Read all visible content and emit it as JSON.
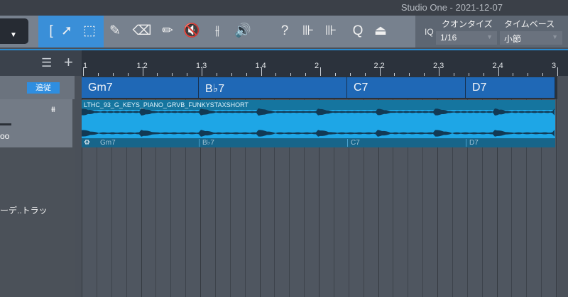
{
  "window": {
    "title": "Studio One - 2021-12-07"
  },
  "toolbar": {
    "tools": [
      {
        "name": "range-bracket-icon",
        "glyph": "["
      },
      {
        "name": "arrow-tool-icon",
        "glyph": "➚"
      },
      {
        "name": "range-tool-icon",
        "glyph": "⬚"
      },
      {
        "name": "split-tool-icon",
        "glyph": "✎"
      },
      {
        "name": "eraser-tool-icon",
        "glyph": "⌫"
      },
      {
        "name": "paint-tool-icon",
        "glyph": "✏"
      },
      {
        "name": "mute-tool-icon",
        "glyph": "🔇"
      },
      {
        "name": "bend-tool-icon",
        "glyph": "⫲"
      },
      {
        "name": "listen-tool-icon",
        "glyph": "🔊"
      },
      {
        "name": "help-icon",
        "glyph": "?"
      },
      {
        "name": "detect-transients-icon",
        "glyph": "⊪"
      },
      {
        "name": "quantize-audio-icon",
        "glyph": "⊪"
      },
      {
        "name": "quantize-icon",
        "glyph": "Q"
      },
      {
        "name": "snap-icon",
        "glyph": "⏏"
      }
    ],
    "iq_label": "IQ",
    "quantize": {
      "label": "クオンタイズ",
      "value": "1/16"
    },
    "timebase": {
      "label": "タイムベース",
      "value": "小節"
    }
  },
  "ruler": {
    "ticks": [
      "1",
      "1.2",
      "1.3",
      "1.4",
      "2",
      "2.2",
      "2.3",
      "2.4",
      "3"
    ]
  },
  "chord_track": {
    "follow_label": "追従",
    "chords": [
      "Gm7",
      "B♭7",
      "C7",
      "D7"
    ]
  },
  "audio_track": {
    "name": "ーデ..トラッ",
    "clip_name": "LTHC_93_G_KEYS_PIANO_GRVB_FUNKYSTAXSHORT",
    "clip_chords": [
      "Gm7",
      "B♭7",
      "C7",
      "D7"
    ]
  }
}
